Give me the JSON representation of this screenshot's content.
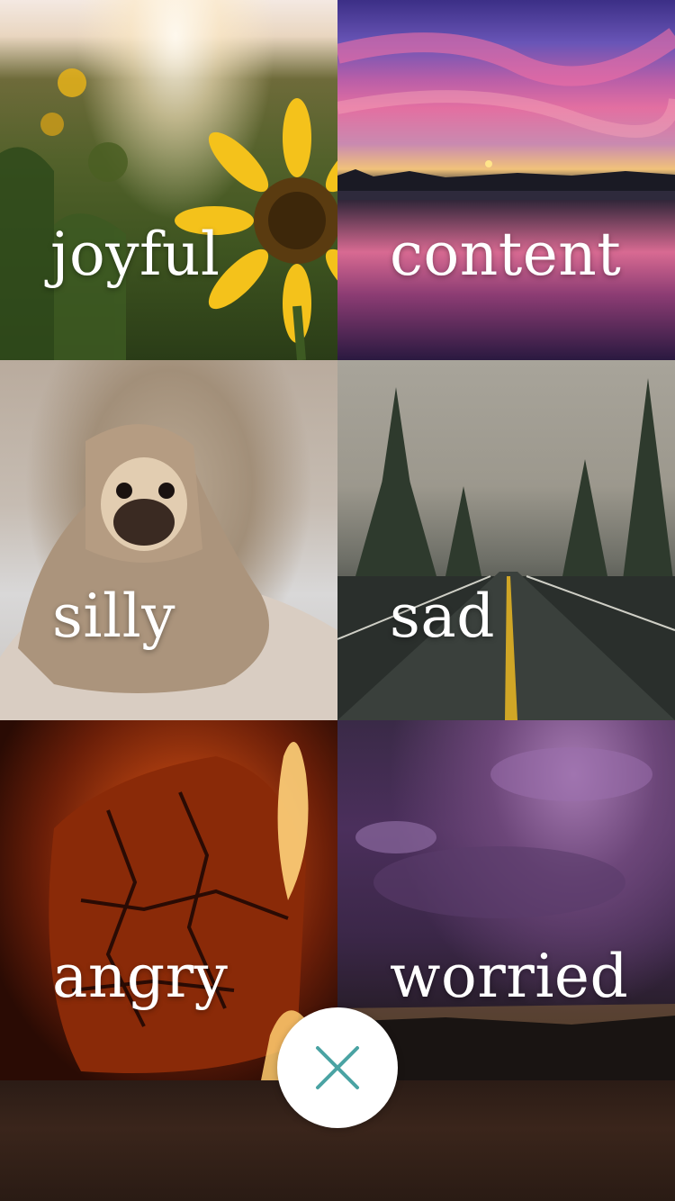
{
  "moods": [
    {
      "label": "joyful"
    },
    {
      "label": "content"
    },
    {
      "label": "silly"
    },
    {
      "label": "sad"
    },
    {
      "label": "angry"
    },
    {
      "label": "worried"
    }
  ],
  "close_button": {
    "icon": "close-icon",
    "color": "#4aa3a3"
  }
}
